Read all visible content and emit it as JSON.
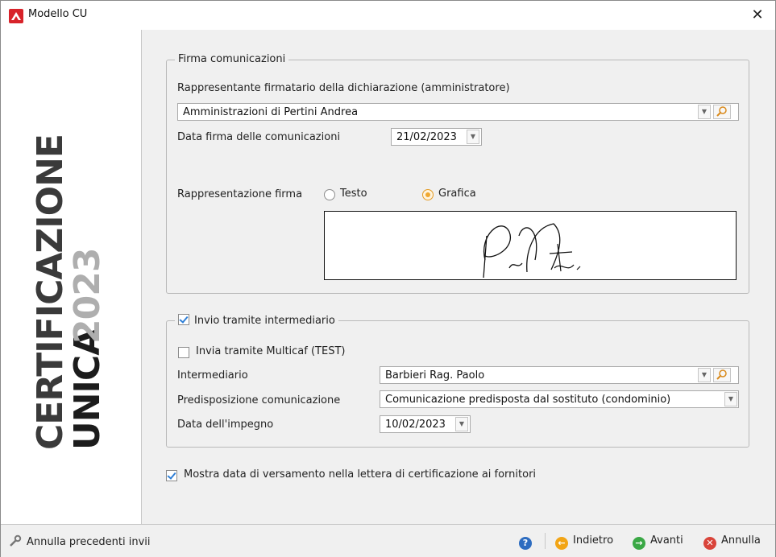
{
  "window": {
    "title": "Modello CU"
  },
  "sidebar": {
    "line1": "CERTIFICAZIONE",
    "line2": "UNICA",
    "year": "2023"
  },
  "firma": {
    "legend": "Firma comunicazioni",
    "rappresentante_label": "Rappresentante firmatario della dichiarazione (amministratore)",
    "rappresentante_value": "Amministrazioni di Pertini Andrea",
    "data_label": "Data firma delle comunicazioni",
    "data_value": "21/02/2023",
    "rappresentazione_label": "Rappresentazione firma",
    "option_testo": "Testo",
    "option_grafica": "Grafica",
    "selected": "Grafica"
  },
  "invio": {
    "legend": "Invio tramite intermediario",
    "checked": true,
    "multicaf_label": "Invia tramite Multicaf (TEST)",
    "multicaf_checked": false,
    "intermediario_label": "Intermediario",
    "intermediario_value": "Barbieri Rag. Paolo",
    "predisposizione_label": "Predisposizione comunicazione",
    "predisposizione_value": "Comunicazione predisposta dal sostituto (condominio)",
    "impegno_label": "Data dell'impegno",
    "impegno_value": "10/02/2023"
  },
  "mostra_data": {
    "label": "Mostra data di versamento nella lettera di certificazione ai fornitori",
    "checked": true
  },
  "statusbar": {
    "annulla_precedenti": "Annulla precedenti invii",
    "indietro": "Indietro",
    "avanti": "Avanti",
    "annulla": "Annulla"
  },
  "colors": {
    "brand_red": "#d8232a",
    "radio_accent": "#f0a830",
    "check_blue": "#2f7fd6",
    "help_blue": "#2d6cc0",
    "back_orange": "#f2a516",
    "next_green": "#3aa845",
    "cancel_red": "#d9443a"
  }
}
